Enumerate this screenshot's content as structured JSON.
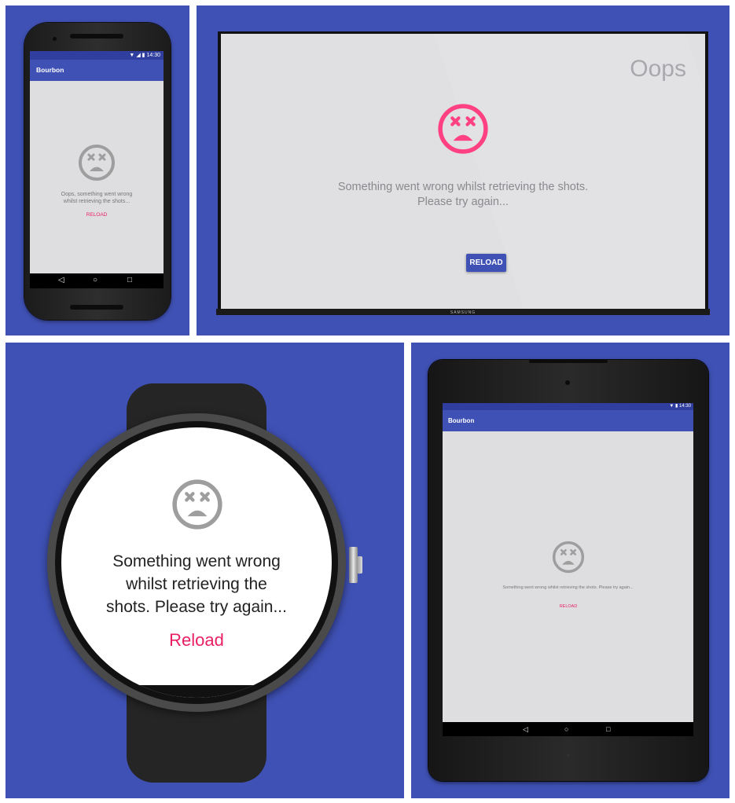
{
  "phone": {
    "status_time": "14:30",
    "app_title": "Bourbon",
    "message": "Oops, something went wrong whilst retrieving the shots...",
    "reload_label": "RELOAD",
    "nav": {
      "back": "◁",
      "home": "○",
      "recents": "□"
    }
  },
  "tv": {
    "heading": "Oops",
    "message_line1": "Something went wrong whilst retrieving the shots.",
    "message_line2": "Please try again...",
    "reload_label": "RELOAD",
    "brand": "SAMSUNG"
  },
  "watch": {
    "message_line1": "Something went wrong",
    "message_line2": "whilst retrieving the",
    "message_line3": "shots. Please try again...",
    "reload_label": "Reload"
  },
  "tablet": {
    "status_time": "14:30",
    "app_title": "Bourbon",
    "message": "Something went wrong whilst retrieving the shots. Please try again...",
    "reload_label": "RELOAD",
    "nav": {
      "back": "◁",
      "home": "○",
      "recents": "□"
    }
  },
  "colors": {
    "background": "#3f51b5",
    "primary_dark": "#303f9f",
    "accent": "#e91e63",
    "tv_accent_face": "#ff4081",
    "face_grey": "#9e9e9e"
  },
  "icons": {
    "error_face": "dead-face-icon",
    "wifi": "wifi-icon",
    "signal": "signal-icon",
    "battery": "battery-icon"
  }
}
